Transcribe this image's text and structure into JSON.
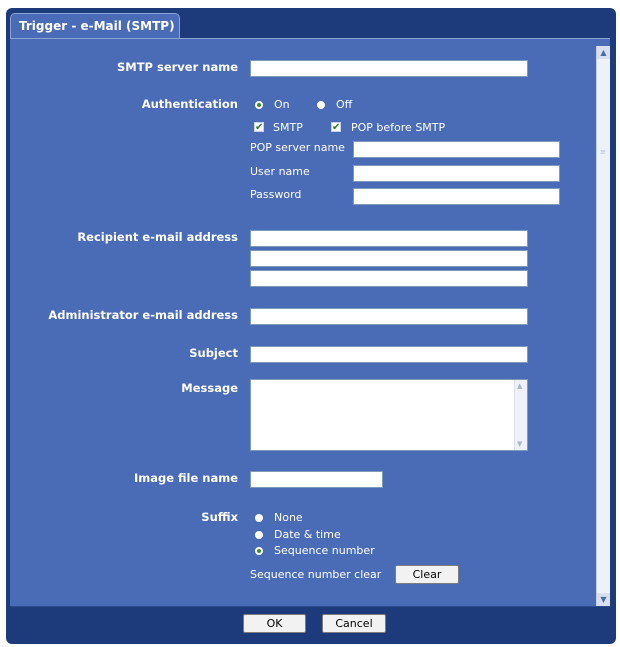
{
  "tab": {
    "title": "Trigger - e-Mail (SMTP)"
  },
  "form": {
    "smtp_server": {
      "label": "SMTP server name",
      "value": ""
    },
    "authentication": {
      "label": "Authentication",
      "on_label": "On",
      "off_label": "Off",
      "selected": "On",
      "smtp_check_label": "SMTP",
      "smtp_checked": true,
      "pop_check_label": "POP before SMTP",
      "pop_checked": true,
      "pop_server_label": "POP server name",
      "pop_server_value": "",
      "user_label": "User name",
      "user_value": "",
      "password_label": "Password",
      "password_value": ""
    },
    "recipient": {
      "label": "Recipient e-mail address",
      "values": [
        "",
        "",
        ""
      ]
    },
    "administrator": {
      "label": "Administrator e-mail address",
      "value": ""
    },
    "subject": {
      "label": "Subject",
      "value": ""
    },
    "message": {
      "label": "Message",
      "value": ""
    },
    "image_file": {
      "label": "Image file name",
      "value": ""
    },
    "suffix": {
      "label": "Suffix",
      "options": [
        "None",
        "Date & time",
        "Sequence number"
      ],
      "selected": "Sequence number",
      "seq_clear_label": "Sequence number clear",
      "clear_button": "Clear"
    }
  },
  "footer": {
    "ok_label": "OK",
    "cancel_label": "Cancel"
  },
  "colors": {
    "panel": "#4a6bb6",
    "frame": "#1d3a7a",
    "radio_selected": "#3e8a2f"
  },
  "icons": {
    "scroll_up": "chevron-up-icon",
    "scroll_down": "chevron-down-icon",
    "check": "checkmark-icon"
  }
}
